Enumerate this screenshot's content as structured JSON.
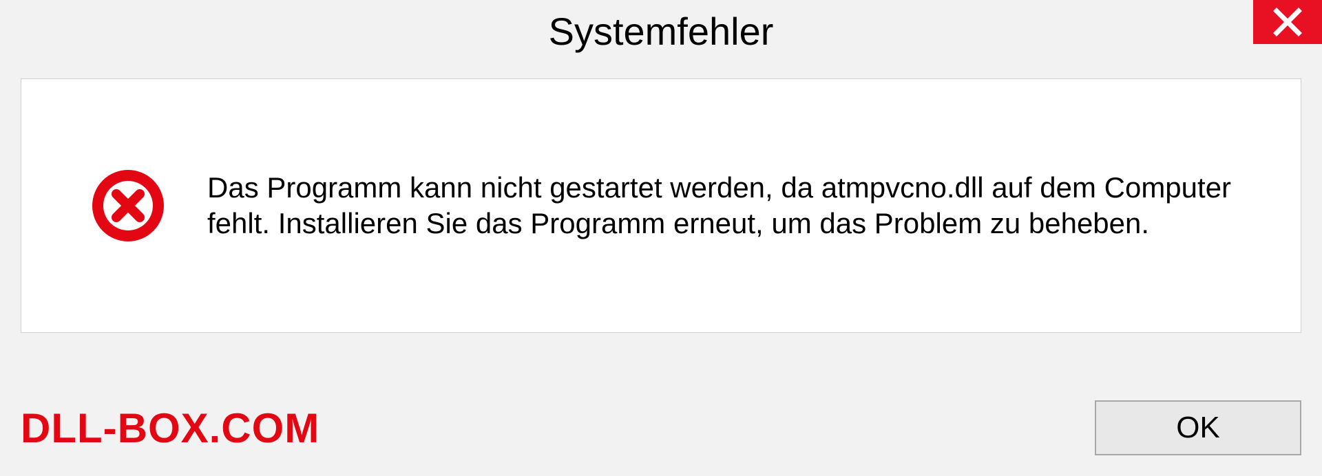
{
  "dialog": {
    "title": "Systemfehler",
    "message": "Das Programm kann nicht gestartet werden, da atmpvcno.dll auf dem Computer fehlt. Installieren Sie das Programm erneut, um das Problem zu beheben.",
    "ok_label": "OK"
  },
  "watermark": "DLL-BOX.COM",
  "colors": {
    "close_bg": "#e81123",
    "error_red": "#e30613",
    "panel_border": "#d0d0d0"
  }
}
